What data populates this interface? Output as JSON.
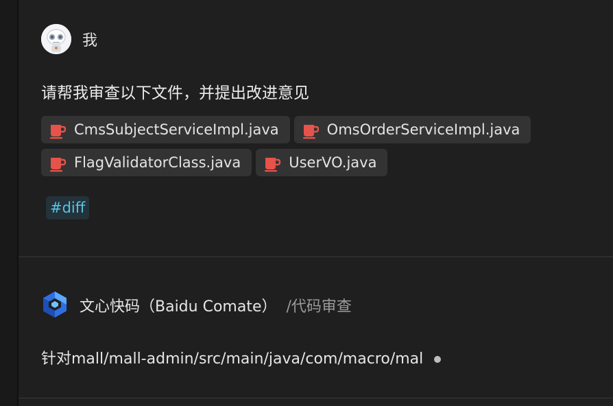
{
  "user_message": {
    "username": "我",
    "prompt": "请帮我审查以下文件，并提出改进意见",
    "files": [
      {
        "name": "CmsSubjectServiceImpl.java",
        "icon": "java-cup-icon"
      },
      {
        "name": "OmsOrderServiceImpl.java",
        "icon": "java-cup-icon"
      },
      {
        "name": "FlagValidatorClass.java",
        "icon": "java-cup-icon"
      },
      {
        "name": "UserVO.java",
        "icon": "java-cup-icon"
      }
    ],
    "tag": "#diff"
  },
  "bot_message": {
    "name": "文心快码（Baidu Comate）",
    "command": "/代码审查",
    "text": "针对mall/mall-admin/src/main/java/com/macro/mal"
  },
  "colors": {
    "background": "#1f1f1f",
    "chip": "#333333",
    "java_icon": "#e5534b",
    "tag_text": "#58c4e6",
    "logo_blue": "#3d8bf2"
  }
}
